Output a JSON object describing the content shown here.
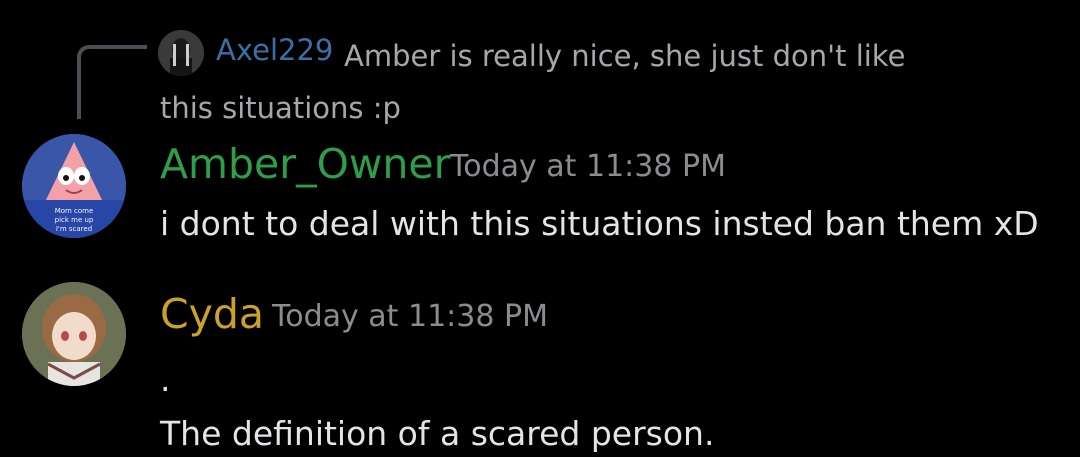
{
  "reply": {
    "author": "Axel229",
    "text": "Amber is really nice, she just don't like this situations :p",
    "author_color": "#3b6fa6"
  },
  "messages": [
    {
      "author": "Amber_Owner",
      "author_color": "#2e9e49",
      "timestamp": "Today at 11:38 PM",
      "lines": [
        "i dont to deal with this situations insted ban them xD"
      ],
      "avatar_caption": [
        "Mom come",
        "pick me up",
        "I'm scared"
      ]
    },
    {
      "author": "Cyda",
      "author_color": "#c9a227",
      "timestamp": "Today at 11:38 PM",
      "lines": [
        ".",
        "The definition of a scared person."
      ]
    }
  ]
}
